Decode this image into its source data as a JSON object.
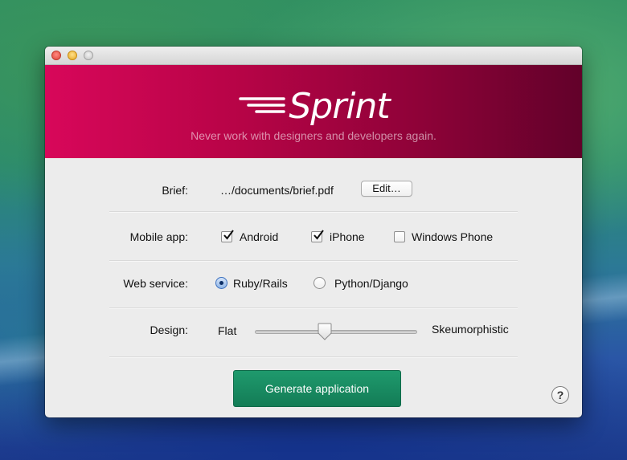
{
  "app": {
    "logo_text": "Sprint",
    "tagline": "Never work with designers and developers again."
  },
  "brief": {
    "label": "Brief:",
    "path": "…/documents/brief.pdf",
    "edit_label": "Edit…"
  },
  "mobile_app": {
    "label": "Mobile app:",
    "options": [
      {
        "label": "Android",
        "checked": true
      },
      {
        "label": "iPhone",
        "checked": true
      },
      {
        "label": "Windows Phone",
        "checked": false
      }
    ]
  },
  "web_service": {
    "label": "Web service:",
    "options": [
      {
        "label": "Ruby/Rails",
        "selected": true
      },
      {
        "label": "Python/Django",
        "selected": false
      }
    ]
  },
  "design": {
    "label": "Design:",
    "min_label": "Flat",
    "max_label": "Skeumorphistic",
    "value_fraction": 0.43
  },
  "actions": {
    "generate_label": "Generate application",
    "help_label": "?"
  },
  "colors": {
    "brand_start": "#d8075a",
    "brand_end": "#62012a",
    "primary_button": "#1f9a6d"
  }
}
